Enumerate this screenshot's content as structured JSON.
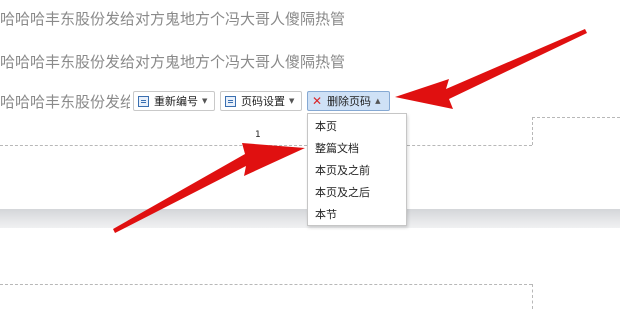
{
  "document": {
    "lines": [
      "哈哈哈丰东股份发给对方鬼地方个冯大哥人傻隔热管",
      "哈哈哈丰东股份发给对方鬼地方个冯大哥人傻隔热管",
      "哈哈哈丰东股份发给对方"
    ],
    "page_number": "1"
  },
  "toolbar": {
    "renumber_label": "重新编号",
    "page_settings_label": "页码设置",
    "delete_page_number_label": "删除页码"
  },
  "dropdown_menu": {
    "items": [
      "本页",
      "整篇文档",
      "本页及之前",
      "本页及之后",
      "本节"
    ]
  },
  "colors": {
    "arrow": "#e01010",
    "active_button": "#cfe1f6",
    "text_gray": "#8a8a8a"
  },
  "icons": {
    "renumber": "renumber-icon",
    "page_settings": "page-settings-icon",
    "delete": "delete-x-icon",
    "caret": "dropdown-caret-icon"
  }
}
